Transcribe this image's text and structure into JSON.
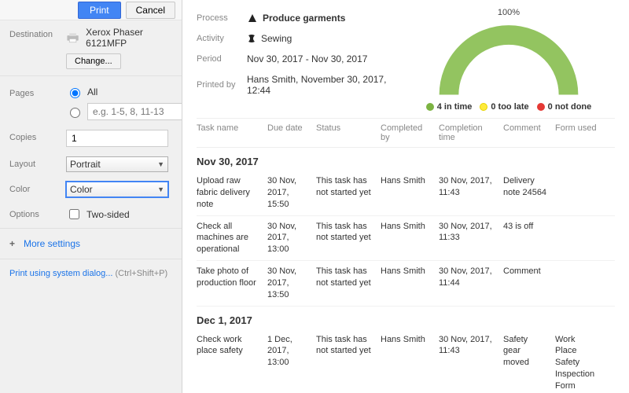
{
  "panel": {
    "print_btn": "Print",
    "cancel_btn": "Cancel",
    "dest_label": "Destination",
    "printer_name": "Xerox Phaser 6121MFP",
    "change_btn": "Change...",
    "pages_label": "Pages",
    "pages_all": "All",
    "pages_placeholder": "e.g. 1-5, 8, 11-13",
    "copies_label": "Copies",
    "copies_value": "1",
    "layout_label": "Layout",
    "layout_value": "Portrait",
    "color_label": "Color",
    "color_value": "Color",
    "options_label": "Options",
    "twosided_label": "Two-sided",
    "more_settings": "More settings",
    "system_dialog": "Print using system dialog...",
    "system_dialog_hint": "(Ctrl+Shift+P)"
  },
  "doc": {
    "meta": {
      "process_label": "Process",
      "process_value": "Produce garments",
      "activity_label": "Activity",
      "activity_value": "Sewing",
      "period_label": "Period",
      "period_value": "Nov 30, 2017 - Nov 30, 2017",
      "printedby_label": "Printed by",
      "printedby_value": "Hans Smith, November 30, 2017, 12:44"
    },
    "gauge_pct": "100%",
    "legend": {
      "in_time": "4 in time",
      "too_late": "0 too late",
      "not_done": "0 not done"
    },
    "table": {
      "headers": {
        "task": "Task name",
        "due": "Due date",
        "status": "Status",
        "by": "Completed by",
        "ctime": "Completion time",
        "comment": "Comment",
        "form": "Form used"
      },
      "groups": [
        {
          "title": "Nov 30, 2017",
          "rows": [
            {
              "task": "Upload raw fabric delivery note",
              "due": "30 Nov, 2017, 15:50",
              "status": "This task has not started yet",
              "by": "Hans Smith",
              "ctime": "30 Nov, 2017, 11:43",
              "comment": "Delivery note 24564",
              "form": ""
            },
            {
              "task": "Check all machines are operational",
              "due": "30 Nov, 2017, 13:00",
              "status": "This task has not started yet",
              "by": "Hans Smith",
              "ctime": "30 Nov, 2017, 11:33",
              "comment": "43 is off",
              "form": ""
            },
            {
              "task": "Take photo of production floor",
              "due": "30 Nov, 2017, 13:50",
              "status": "This task has not started yet",
              "by": "Hans Smith",
              "ctime": "30 Nov, 2017, 11:44",
              "comment": "Comment",
              "form": ""
            }
          ]
        },
        {
          "title": "Dec 1, 2017",
          "rows": [
            {
              "task": "Check work place safety",
              "due": "1 Dec, 2017, 13:00",
              "status": "This task has not started yet",
              "by": "Hans Smith",
              "ctime": "30 Nov, 2017, 11:43",
              "comment": "Safety gear moved",
              "form": "Work Place Safety Inspection Form"
            }
          ]
        }
      ]
    }
  },
  "chart_data": {
    "type": "pie",
    "title": "Completion status",
    "categories": [
      "in time",
      "too late",
      "not done"
    ],
    "values": [
      4,
      0,
      0
    ],
    "colors": [
      "#7cb342",
      "#ffeb3b",
      "#e53935"
    ],
    "percent_label": "100%"
  }
}
